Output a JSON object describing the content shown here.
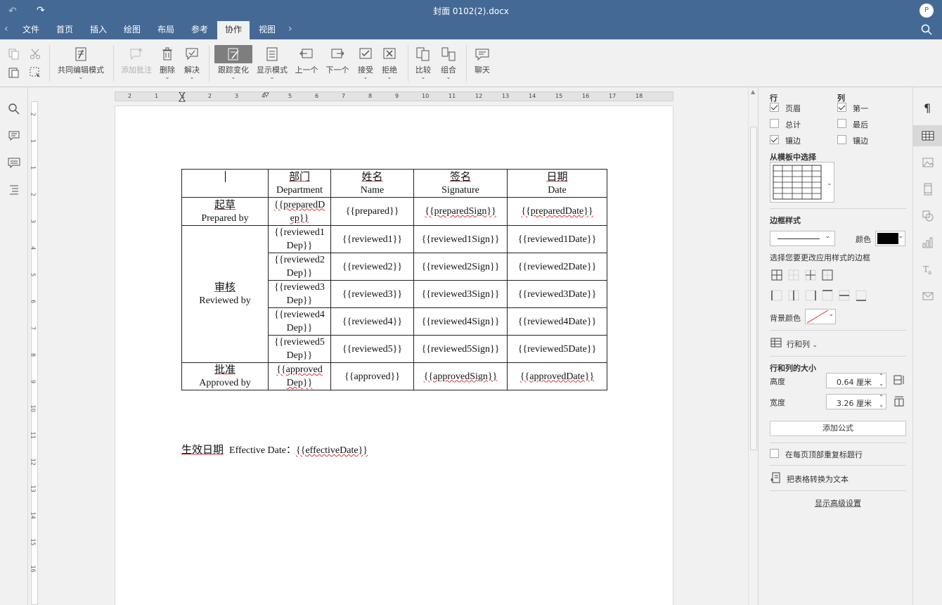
{
  "window": {
    "title": "封面 0102(2).docx",
    "user_initial": "P"
  },
  "tabs": [
    "文件",
    "首页",
    "插入",
    "绘图",
    "布局",
    "参考",
    "协作",
    "视图"
  ],
  "active_tab": "协作",
  "toolbar": {
    "coedit_mode": "共同编辑模式",
    "add_comment": "添加批注",
    "delete": "删除",
    "resolve": "解决",
    "track_changes": "跟踪变化",
    "display_mode": "显示模式",
    "prev": "上一个",
    "next": "下一个",
    "accept": "接受",
    "reject": "拒绝",
    "compare": "比较",
    "combine": "组合",
    "chat": "聊天"
  },
  "ruler": {
    "h_numbers": [
      "2",
      "1",
      "1",
      "2",
      "3",
      "4",
      "5",
      "6",
      "7",
      "8",
      "9",
      "10",
      "11",
      "12",
      "13",
      "14",
      "15",
      "16",
      "17",
      "18"
    ],
    "v_numbers": [
      "2",
      "1",
      "1",
      "2",
      "3",
      "4",
      "5",
      "6",
      "7",
      "8",
      "9",
      "10",
      "11",
      "12",
      "13",
      "14",
      "15",
      "16"
    ]
  },
  "document": {
    "header_row": [
      {
        "cn": "",
        "en": ""
      },
      {
        "cn": "部门",
        "en": "Department"
      },
      {
        "cn": "姓名",
        "en": "Name"
      },
      {
        "cn": "签名",
        "en": "Signature"
      },
      {
        "cn": "日期",
        "en": "Date"
      }
    ],
    "prepared": {
      "cn": "起草",
      "en": "Prepared by",
      "dep": [
        "{{preparedD",
        "ep}}"
      ],
      "name": "{{prepared}}",
      "sign": "{{preparedSign}}",
      "date": "{{preparedDate}}"
    },
    "reviewed": {
      "cn": "审核",
      "en": "Reviewed by",
      "rows": [
        {
          "dep": [
            "{{reviewed1",
            "Dep}}"
          ],
          "name": "{{reviewed1}}",
          "sign": "{{reviewed1Sign}}",
          "date": "{{reviewed1Date}}"
        },
        {
          "dep": [
            "{{reviewed2",
            "Dep}}"
          ],
          "name": "{{reviewed2}}",
          "sign": "{{reviewed2Sign}}",
          "date": "{{reviewed2Date}}"
        },
        {
          "dep": [
            "{{reviewed3",
            "Dep}}"
          ],
          "name": "{{reviewed3}}",
          "sign": "{{reviewed3Sign}}",
          "date": "{{reviewed3Date}}"
        },
        {
          "dep": [
            "{{reviewed4",
            "Dep}}"
          ],
          "name": "{{reviewed4}}",
          "sign": "{{reviewed4Sign}}",
          "date": "{{reviewed4Date}}"
        },
        {
          "dep": [
            "{{reviewed5",
            "Dep}}"
          ],
          "name": "{{reviewed5}}",
          "sign": "{{reviewed5Sign}}",
          "date": "{{reviewed5Date}}"
        }
      ]
    },
    "approved": {
      "cn": "批准",
      "en": "Approved by",
      "dep": [
        "{{approved",
        "Dep}}"
      ],
      "name": "{{approved}}",
      "sign": "{{approvedSign}}",
      "date": "{{approvedDate}}"
    },
    "effective": {
      "cn": "生效日期",
      "en": "Effective Date：",
      "value": "{{effectiveDate}}"
    }
  },
  "table_settings": {
    "rows_label": "行",
    "cols_label": "列",
    "header_row": {
      "label": "页眉",
      "checked": true
    },
    "total_row": {
      "label": "总计",
      "checked": false
    },
    "banded_rows": {
      "label": "镶边",
      "checked": true
    },
    "first_col": {
      "label": "第一",
      "checked": true
    },
    "last_col": {
      "label": "最后",
      "checked": false
    },
    "banded_cols": {
      "label": "镶边",
      "checked": false
    },
    "template_label": "从模板中选择",
    "border_style_label": "边框样式",
    "color_label": "颜色",
    "border_color": "#000000",
    "apply_border_label": "选择您要更改应用样式的边框",
    "bg_color_label": "背景颜色",
    "rows_cols_label": "行和列",
    "size_label": "行和列的大小",
    "height_label": "高度",
    "height_value": "0.64 厘米",
    "width_label": "宽度",
    "width_value": "3.26 厘米",
    "add_formula": "添加公式",
    "repeat_header": {
      "label": "在每页顶部重复标题行",
      "checked": false
    },
    "convert_to_text": "把表格转换为文本",
    "advanced": "显示高级设置"
  },
  "colors": {
    "titlebar": "#446995",
    "accent_red": "#dd3333"
  }
}
